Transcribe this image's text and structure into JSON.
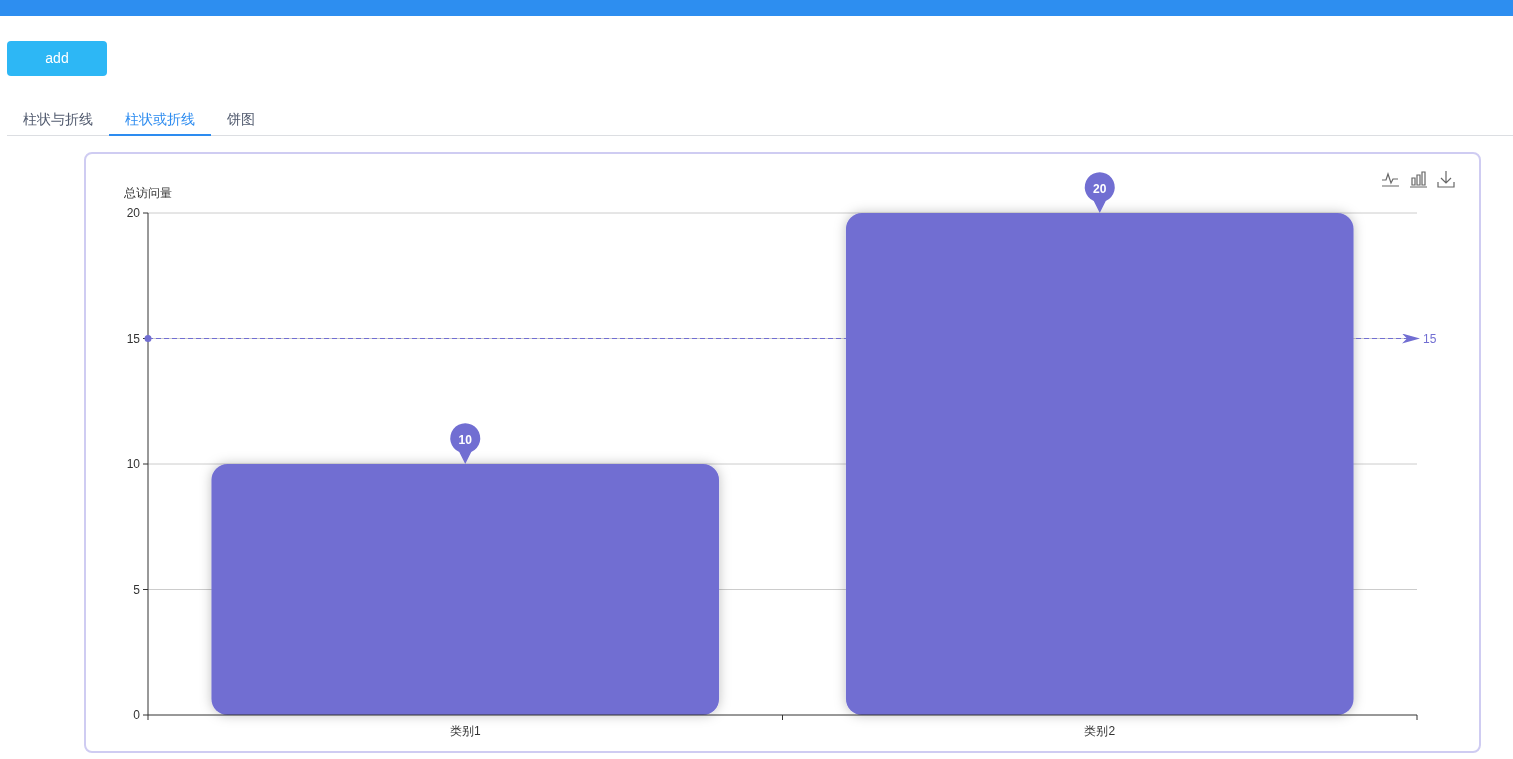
{
  "add_button": {
    "label": "add"
  },
  "tabs": [
    {
      "label": "柱状与折线",
      "selected": false
    },
    {
      "label": "柱状或折线",
      "selected": true
    },
    {
      "label": "饼图",
      "selected": false
    }
  ],
  "toolbox": [
    {
      "kind": "line"
    },
    {
      "kind": "bar"
    },
    {
      "kind": "download"
    }
  ],
  "chart_data": {
    "type": "bar",
    "ylabel": "总访问量",
    "categories": [
      "类别1",
      "类别2"
    ],
    "series": [
      {
        "color": "#716ed2",
        "values": [
          10,
          20
        ]
      }
    ],
    "ylim": [
      0,
      20
    ],
    "yticks": [
      0,
      5,
      10,
      15,
      20
    ],
    "grid": true,
    "ref_lines": [
      {
        "axis": "y",
        "value": 15,
        "label": "15"
      }
    ],
    "annotations": [
      {
        "text": "10",
        "x": "类别1",
        "y": 10
      },
      {
        "text": "20",
        "x": "类别2",
        "y": 20
      }
    ]
  }
}
